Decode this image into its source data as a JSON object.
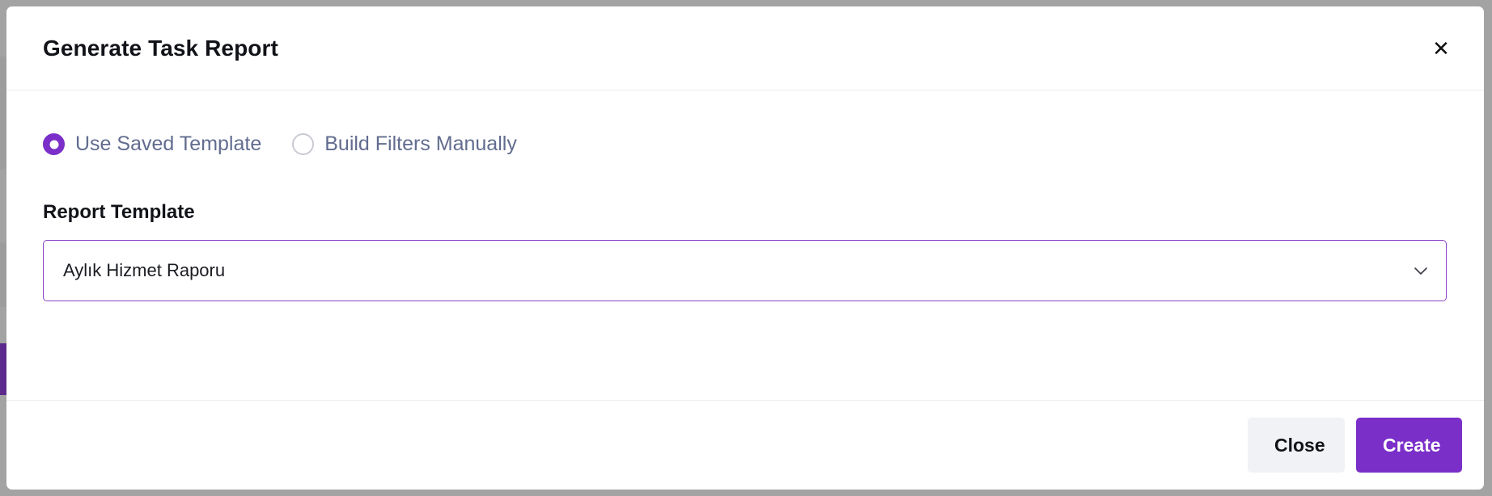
{
  "modal": {
    "title": "Generate Task Report",
    "close_icon": "close-icon"
  },
  "mode": {
    "options": [
      {
        "label": "Use Saved Template",
        "checked": true
      },
      {
        "label": "Build Filters Manually",
        "checked": false
      }
    ]
  },
  "template": {
    "label": "Report Template",
    "selected": "Aylık Hizmet Raporu",
    "icon": "chevron-down-icon"
  },
  "footer": {
    "close_label": "Close",
    "create_label": "Create"
  },
  "colors": {
    "accent": "#7b2fc9",
    "radio_label": "#626c8f",
    "close_button_bg": "#f1f2f5"
  }
}
